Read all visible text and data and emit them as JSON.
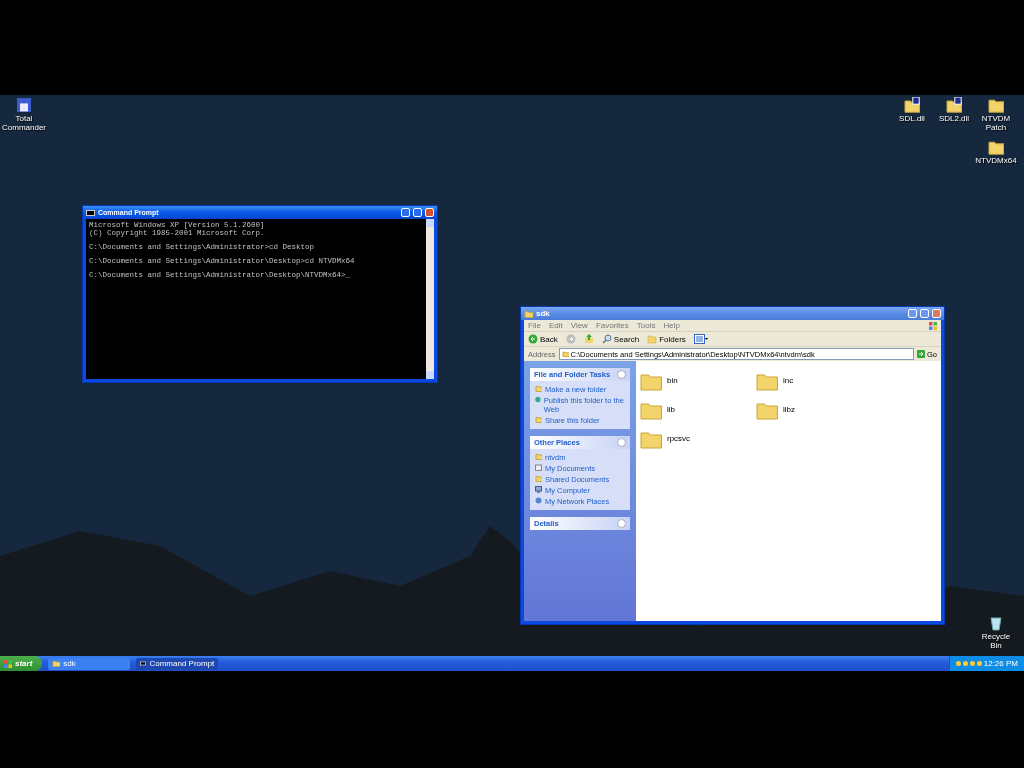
{
  "desktop_icons": [
    {
      "label": "Total Commander",
      "kind": "app"
    },
    {
      "label": "SDL.dll",
      "kind": "file"
    },
    {
      "label": "SDL2.dll",
      "kind": "file"
    },
    {
      "label": "NTVDM Patch",
      "kind": "folder"
    },
    {
      "label": "NTVDMx64",
      "kind": "folder"
    },
    {
      "label": "Recycle Bin",
      "kind": "bin"
    }
  ],
  "command_prompt": {
    "title": "Command Prompt",
    "blocks": [
      [
        "Microsoft Windows XP [Version 5.1.2600]",
        "(C) Copyright 1985-2001 Microsoft Corp."
      ],
      [
        "C:\\Documents and Settings\\Administrator>cd Desktop"
      ],
      [
        "C:\\Documents and Settings\\Administrator\\Desktop>cd NTVDMx64"
      ],
      [
        "C:\\Documents and Settings\\Administrator\\Desktop\\NTVDMx64>_"
      ]
    ]
  },
  "explorer": {
    "title": "sdk",
    "menu": [
      "File",
      "Edit",
      "View",
      "Favorites",
      "Tools",
      "Help"
    ],
    "toolbar": [
      {
        "label": "Back",
        "kind": "back"
      },
      {
        "kind": "forward"
      },
      {
        "kind": "up"
      },
      {
        "label": "Search",
        "kind": "search"
      },
      {
        "label": "Folders",
        "kind": "folders"
      },
      {
        "kind": "views"
      }
    ],
    "address_label": "Address",
    "address": "C:\\Documents and Settings\\Administrator\\Desktop\\NTVDMx64\\ntvdm\\sdk",
    "go": "Go",
    "panels": [
      {
        "title": "File and Folder Tasks",
        "items": [
          {
            "label": "Make a new folder",
            "kind": "newfolder"
          },
          {
            "label": "Publish this folder to the Web",
            "kind": "web"
          },
          {
            "label": "Share this folder",
            "kind": "share"
          }
        ]
      },
      {
        "title": "Other Places",
        "items": [
          {
            "label": "ntvdm",
            "kind": "folder"
          },
          {
            "label": "My Documents",
            "kind": "docs"
          },
          {
            "label": "Shared Documents",
            "kind": "folder"
          },
          {
            "label": "My Computer",
            "kind": "computer"
          },
          {
            "label": "My Network Places",
            "kind": "network"
          }
        ]
      },
      {
        "title": "Details"
      }
    ],
    "files": [
      "bin",
      "inc",
      "lib",
      "libz",
      "rpcsvc"
    ]
  },
  "taskbar": {
    "start": "start",
    "tasks": [
      {
        "label": "sdk",
        "kind": "folder",
        "selected": false
      },
      {
        "label": "Command Prompt",
        "kind": "cmd",
        "selected": true
      }
    ],
    "clock": "12:26 PM"
  }
}
